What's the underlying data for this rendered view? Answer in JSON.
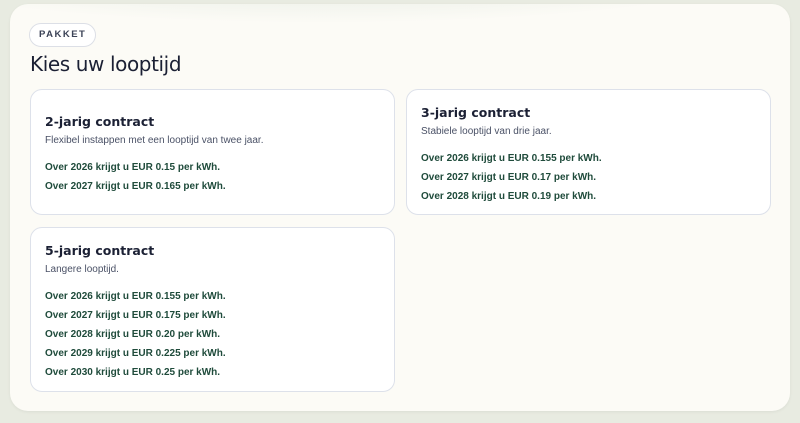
{
  "badge": "PAKKET",
  "title": "Kies uw looptijd",
  "contracts": [
    {
      "title": "2-jarig contract",
      "description": "Flexibel instappen met een looptijd van twee jaar.",
      "rates": [
        "Over 2026 krijgt u EUR 0.15 per kWh.",
        "Over 2027 krijgt u EUR 0.165 per kWh."
      ]
    },
    {
      "title": "3-jarig contract",
      "description": "Stabiele looptijd van drie jaar.",
      "rates": [
        "Over 2026 krijgt u EUR 0.155 per kWh.",
        "Over 2027 krijgt u EUR 0.17 per kWh.",
        "Over 2028 krijgt u EUR 0.19 per kWh."
      ]
    },
    {
      "title": "5-jarig contract",
      "description": "Langere looptijd.",
      "rates": [
        "Over 2026 krijgt u EUR 0.155 per kWh.",
        "Over 2027 krijgt u EUR 0.175 per kWh.",
        "Over 2028 krijgt u EUR 0.20 per kWh.",
        "Over 2029 krijgt u EUR 0.225 per kWh.",
        "Over 2030 krijgt u EUR 0.25 per kWh."
      ]
    }
  ],
  "colors": {
    "rate_text": "#1f4b3b",
    "title_text": "#1b2034",
    "card_border": "#dde1ea",
    "panel_background": "#fcfbf6"
  }
}
